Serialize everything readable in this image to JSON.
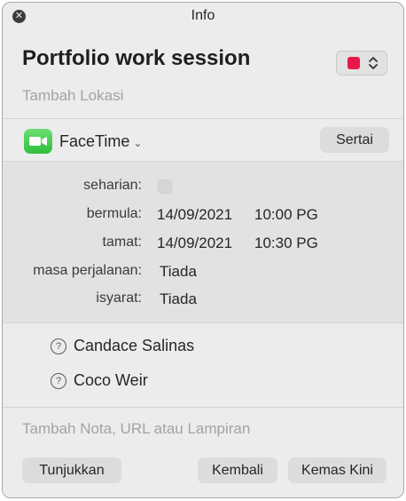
{
  "window": {
    "title": "Info"
  },
  "event": {
    "title": "Portfolio work session",
    "location_placeholder": "Tambah Lokasi",
    "calendar_color": "#e8174a"
  },
  "conference": {
    "app": "FaceTime",
    "join_label": "Sertai"
  },
  "details": {
    "all_day_label": "seharian:",
    "start_label": "bermula:",
    "start_date": "14/09/2021",
    "start_time": "10:00 PG",
    "end_label": "tamat:",
    "end_date": "14/09/2021",
    "end_time": "10:30 PG",
    "travel_label": "masa perjalanan:",
    "travel_value": "Tiada",
    "alert_label": "isyarat:",
    "alert_value": "Tiada"
  },
  "invitees": [
    {
      "name": "Candace Salinas"
    },
    {
      "name": "Coco Weir"
    }
  ],
  "notes_placeholder": "Tambah Nota, URL atau Lampiran",
  "buttons": {
    "show": "Tunjukkan",
    "revert": "Kembali",
    "update": "Kemas Kini"
  }
}
